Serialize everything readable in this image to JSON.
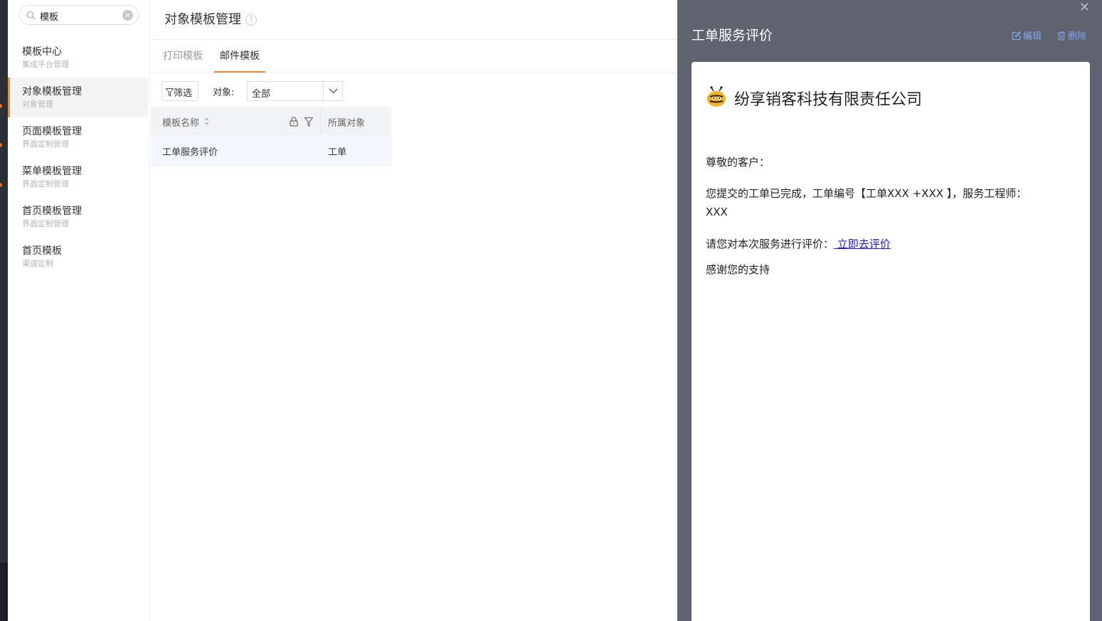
{
  "sidebar": {
    "search_value": "模板",
    "items": [
      {
        "title": "模板中心",
        "subtitle": "集成平台管理"
      },
      {
        "title": "对象模板管理",
        "subtitle": "对象管理"
      },
      {
        "title": "页面模板管理",
        "subtitle": "界面定制管理"
      },
      {
        "title": "菜单模板管理",
        "subtitle": "界面定制管理"
      },
      {
        "title": "首页模板管理",
        "subtitle": "界面定制管理"
      },
      {
        "title": "首页模板",
        "subtitle": "渠道定制"
      }
    ],
    "active_index": 1
  },
  "main": {
    "title": "对象模板管理",
    "tabs": [
      "打印模板",
      "邮件模板"
    ],
    "active_tab": 1,
    "filter_label": "筛选",
    "object_label": "对象:",
    "object_value": "全部",
    "table": {
      "columns": [
        "模板名称",
        "所属对象"
      ],
      "rows": [
        [
          "工单服务评价",
          "工单"
        ]
      ]
    }
  },
  "panel": {
    "title": "工单服务评价",
    "edit_label": "编辑",
    "delete_label": "删除",
    "company": "纷享销客科技有限责任公司",
    "greeting": "尊敬的客户：",
    "line1": "您提交的工单已完成，工单编号【工单XXX +XXX 】，服务工程师：",
    "line1b": "XXX",
    "line2_prefix": "请您对本次服务进行评价：",
    "line2_link": " 立即去评价",
    "line3": "感谢您的支持"
  },
  "colors": {
    "accent": "#f08c3a",
    "panel_bg": "#5f6370",
    "link": "#1e1ed2",
    "action": "#7fa6e8"
  }
}
